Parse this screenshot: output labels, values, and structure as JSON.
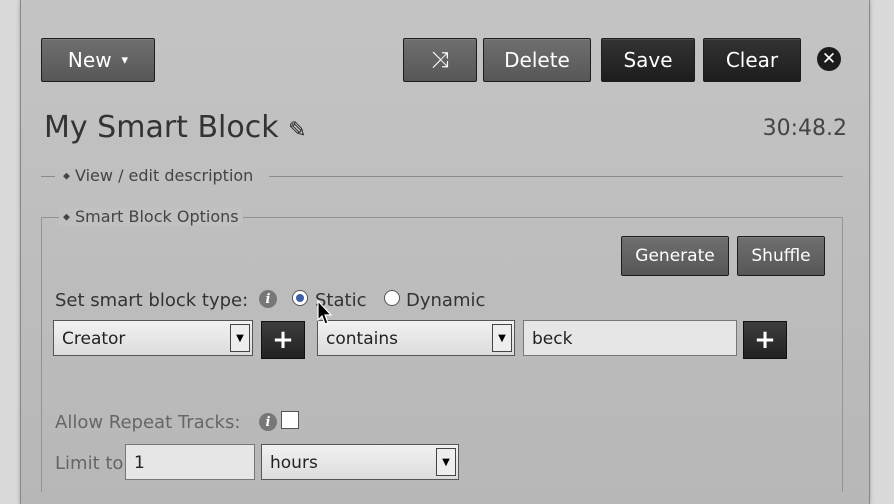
{
  "toolbar": {
    "new_label": "New",
    "new_caret": "▾",
    "shuffle_icon": "⤨",
    "delete_label": "Delete",
    "save_label": "Save",
    "clear_label": "Clear",
    "close_icon": "✕"
  },
  "header": {
    "title": "My Smart Block",
    "edit_icon": "✎",
    "duration": "30:48.2"
  },
  "description_section": {
    "toggle": "◆",
    "label": "View / edit description"
  },
  "options_section": {
    "toggle": "◆",
    "label": "Smart Block Options",
    "generate_label": "Generate",
    "shuffle_label": "Shuffle",
    "type_label": "Set smart block type:",
    "info_icon": "i",
    "type_options": [
      {
        "label": "Static",
        "selected": true
      },
      {
        "label": "Dynamic",
        "selected": false
      }
    ],
    "criteria": {
      "field": "Creator",
      "modifier": "contains",
      "value": "beck",
      "add_icon": "+"
    },
    "repeat_label": "Allow Repeat Tracks:",
    "repeat_checked": false,
    "limit_label": "Limit to",
    "limit_value": "1",
    "limit_unit": "hours"
  },
  "colors": {
    "panel_bg": "#c0c0c0",
    "button_gray": "#5f5f5f",
    "button_dark": "#262626",
    "radio_accent": "#3c5fa8"
  }
}
